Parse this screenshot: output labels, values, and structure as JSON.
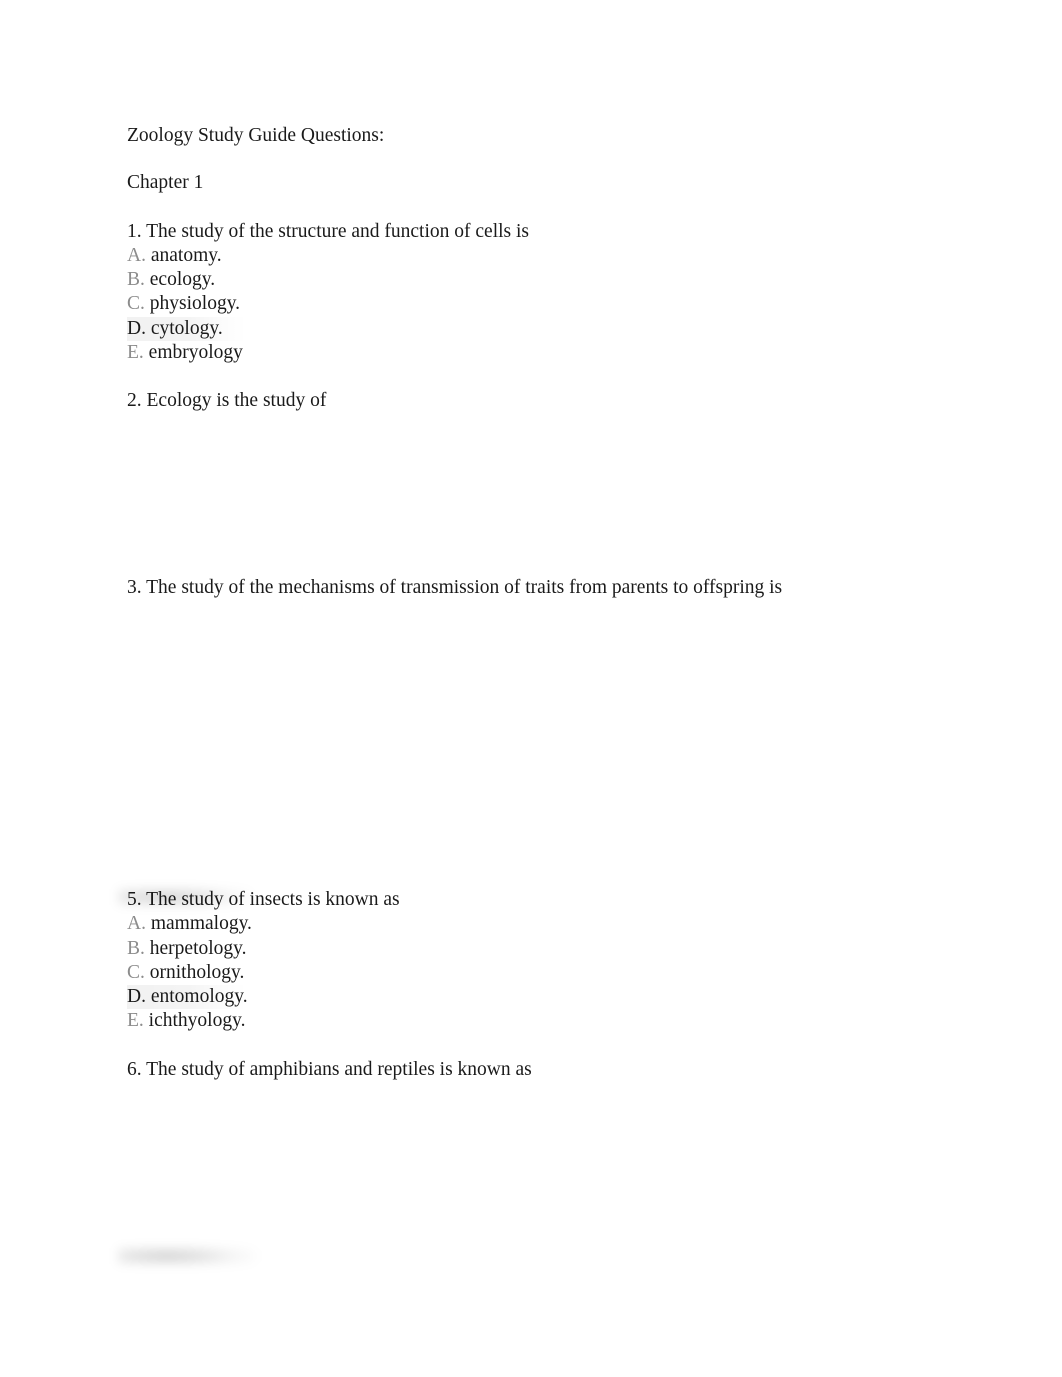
{
  "document": {
    "title": "Zoology Study Guide Questions:",
    "chapter": "Chapter 1",
    "questions": [
      {
        "number": "1.",
        "stem": "1. The study of the structure and function of cells is",
        "options": [
          {
            "marker": "A.",
            "text": " anatomy.",
            "correct": false
          },
          {
            "marker": "B.",
            "text": " ecology.",
            "correct": false
          },
          {
            "marker": "C.",
            "text": " physiology.",
            "correct": false
          },
          {
            "marker": "D.",
            "text": " cytology.",
            "correct": true
          },
          {
            "marker": "E.",
            "text": " embryology",
            "correct": false
          }
        ]
      },
      {
        "number": "2.",
        "stem": "2. Ecology is the study of",
        "options": []
      },
      {
        "number": "3.",
        "stem": "3. The study of the mechanisms of transmission of traits from parents to offspring is",
        "options": []
      },
      {
        "number": "5.",
        "stem": "5. The study of insects is known as",
        "options": [
          {
            "marker": "A.",
            "text": " mammalogy.",
            "correct": false
          },
          {
            "marker": "B.",
            "text": " herpetology.",
            "correct": false
          },
          {
            "marker": "C.",
            "text": " ornithology.",
            "correct": false
          },
          {
            "marker": "D.",
            "text": " entomology.",
            "correct": true
          },
          {
            "marker": "E.",
            "text": " ichthyology.",
            "correct": false
          }
        ]
      },
      {
        "number": "6.",
        "stem": "6. The study of amphibians and reptiles is known as",
        "options": []
      }
    ]
  },
  "colors": {
    "page_background": "#ffffff",
    "body_text": "#1a1a1a",
    "option_marker_muted": "#8c8c8c",
    "correct_highlight": "rgba(0,0,0,0.05)"
  }
}
